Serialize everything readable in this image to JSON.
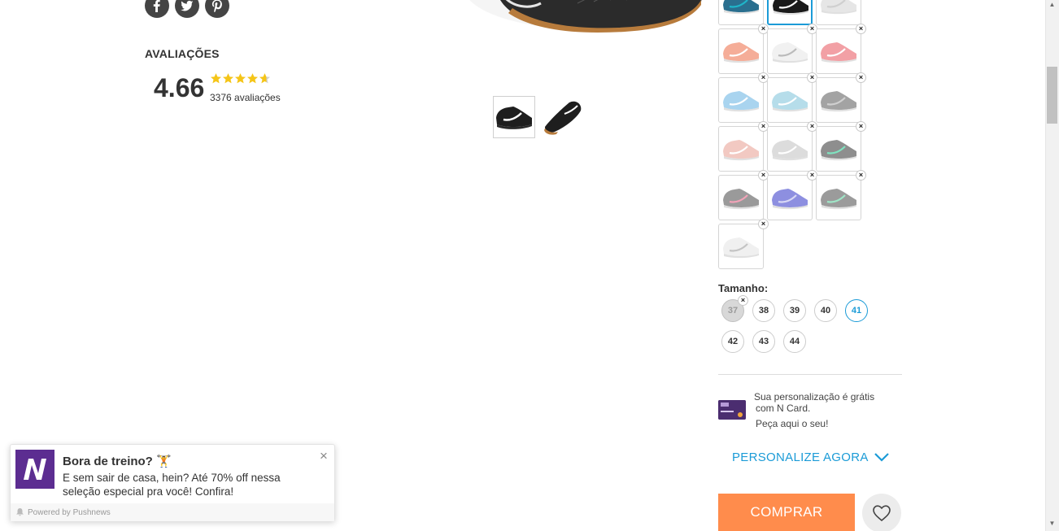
{
  "reviews": {
    "title": "AVALIAÇÕES",
    "rating": "4.66",
    "rating_fraction": 0.932,
    "count_text": "3376 avaliações"
  },
  "social": {
    "items": [
      "facebook-icon",
      "twitter-icon",
      "pinterest-icon"
    ]
  },
  "product": {
    "main_image": "black-shoe",
    "thumbnails": [
      "black-shoe-side",
      "black-shoe-angle"
    ]
  },
  "colors": {
    "swatches": [
      {
        "color": "#2a6f8f",
        "accent": "#1fb5c9",
        "badge": false
      },
      {
        "color": "#1a1a1a",
        "accent": "#ffffff",
        "badge": false,
        "active": true
      },
      {
        "color": "#e6e6e6",
        "accent": "#cfcfcf",
        "badge": false
      },
      {
        "color": "#f5ad98",
        "accent": "#ffffff",
        "badge": true
      },
      {
        "color": "#f1f1f1",
        "accent": "#bbbbbb",
        "badge": true
      },
      {
        "color": "#f2a0a5",
        "accent": "#ffffff",
        "badge": true
      },
      {
        "color": "#a9d4ef",
        "accent": "#ffffff",
        "badge": true
      },
      {
        "color": "#b6ddea",
        "accent": "#ffffff",
        "badge": true
      },
      {
        "color": "#a3a3a3",
        "accent": "#d0d0d0",
        "badge": true
      },
      {
        "color": "#f2c9c2",
        "accent": "#ffffff",
        "badge": true
      },
      {
        "color": "#dcdcdc",
        "accent": "#ffffff",
        "badge": true
      },
      {
        "color": "#8e8e8e",
        "accent": "#7fe3c0",
        "badge": true
      },
      {
        "color": "#9a9a9a",
        "accent": "#f2a3b8",
        "badge": true
      },
      {
        "color": "#8d8fe0",
        "accent": "#d8d8f5",
        "badge": true
      },
      {
        "color": "#9b9b9b",
        "accent": "#9fe6c7",
        "badge": true
      },
      {
        "color": "#f0f0f0",
        "accent": "#c4c4c4",
        "badge": true
      }
    ]
  },
  "size": {
    "label": "Tamanho:",
    "options": [
      {
        "value": "37",
        "state": "unavailable"
      },
      {
        "value": "38",
        "state": "available"
      },
      {
        "value": "39",
        "state": "available"
      },
      {
        "value": "40",
        "state": "available"
      },
      {
        "value": "41",
        "state": "selected"
      },
      {
        "value": "42",
        "state": "available"
      },
      {
        "value": "43",
        "state": "available"
      },
      {
        "value": "44",
        "state": "available"
      }
    ]
  },
  "ncard": {
    "line1": "Sua personalização é grátis",
    "line2": "com N Card.",
    "line3": "Peça aqui o seu!"
  },
  "personalize": {
    "label": "PERSONALIZE AGORA"
  },
  "buy": {
    "label": "COMPRAR"
  },
  "push": {
    "title": "Bora de treino? 🏋",
    "body": "E sem sair de casa, hein? Até 70% off nessa seleção especial pra você! Confira!",
    "powered": "Powered by Pushnews",
    "close": "×"
  },
  "theme": {
    "accent": "#1b9bd7",
    "buy": "#ff8c4c",
    "brand": "#5c2d91",
    "star": "#f5c518"
  }
}
